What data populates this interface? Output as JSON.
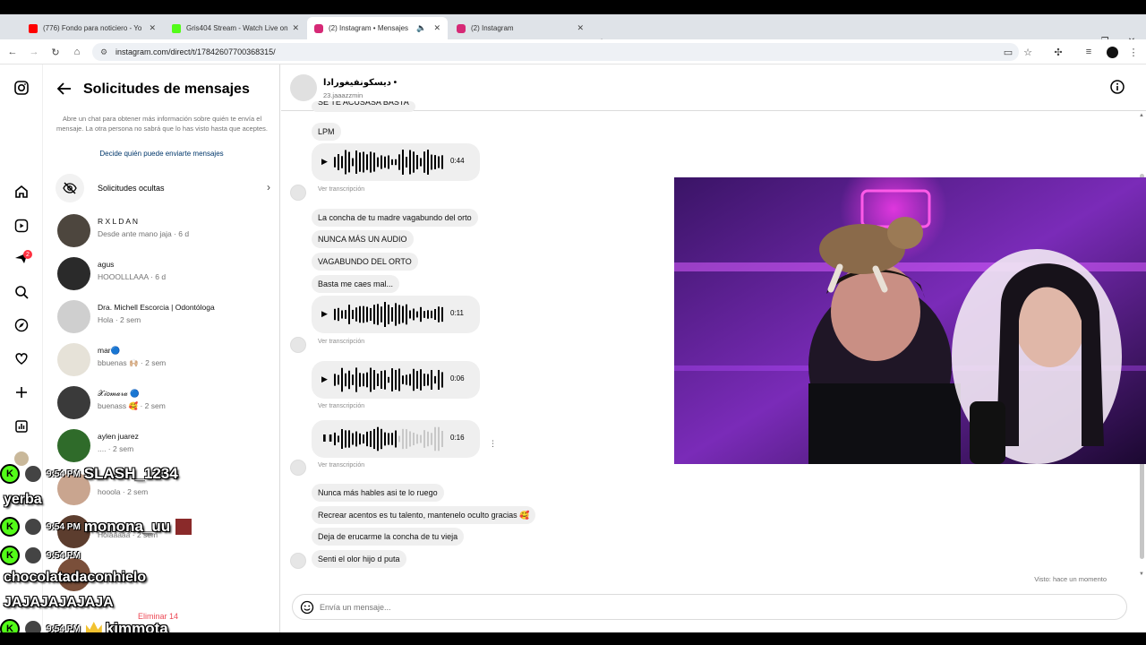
{
  "browser": {
    "tabs": [
      {
        "title": "(776) Fondo para noticiero - Yo",
        "favicon_color": "#ff0000"
      },
      {
        "title": "Gris404 Stream - Watch Live on",
        "favicon_color": "#53fc18"
      },
      {
        "title": "(2) Instagram • Mensajes",
        "favicon_color": "#d62976"
      },
      {
        "title": "(2) Instagram",
        "favicon_color": "#d62976"
      }
    ],
    "new_tab": "+",
    "url": "instagram.com/direct/t/17842607700368315/"
  },
  "rail": {
    "notification_count": "2"
  },
  "requests": {
    "title": "Solicitudes de mensajes",
    "description": "Abre un chat para obtener más información sobre quién te envía el mensaje. La otra persona no sabrá que lo has visto hasta que aceptes.",
    "decide_link": "Decide quién puede enviarte mensajes",
    "hidden_label": "Solicitudes ocultas",
    "items": [
      {
        "name": "R X L D A N",
        "preview": "Desde ante mano jaja · 6 d"
      },
      {
        "name": "agus",
        "preview": "HOOOLLLAAA · 6 d"
      },
      {
        "name": "Dra. Michell Escorcia | Odontóloga",
        "preview": "Hola · 2 sem"
      },
      {
        "name": "mar🔵",
        "preview": "bbuenas 🙌🏼 · 2 sem"
      },
      {
        "name": "𝒳𝒾𝑜𝓂𝒶𝓇𝒶 🔵",
        "preview": "buenass 🥰 · 2 sem"
      },
      {
        "name": "aylen juarez",
        "preview": ".... · 2 sem"
      },
      {
        "name": "",
        "preview": "hooola · 2 sem"
      },
      {
        "name": "",
        "preview": "Holaaaaa · 2 sem"
      },
      {
        "name": "",
        "preview": ""
      }
    ],
    "delete_all": "Eliminar 14"
  },
  "chat": {
    "name": "دیسکونفیغورادا •",
    "username": "23.jaaazzmin",
    "messages": {
      "m0": "SE TE ACUSASA BASTA",
      "m1": "LPM",
      "v1_duration": "0:44",
      "transcript": "Ver transcripción",
      "m2": "La concha de tu madre vagabundo del orto",
      "m3": "NUNCA MÁS UN AUDIO",
      "m4": "VAGABUNDO DEL ORTO",
      "m5": "Basta me caes mal...",
      "v2_duration": "0:11",
      "v3_duration": "0:06",
      "v4_duration": "0:16",
      "m6": "Nunca más hables asi te lo ruego",
      "m7": "Recrear acentos es tu talento, mantenelo oculto gracias 🥰",
      "m8": "Deja de erucarme la concha de tu vieja",
      "m9": "Senti el olor hijo d puta"
    },
    "seen": "Visto: hace un momento",
    "composer_placeholder": "Envía un mensaje..."
  },
  "stream_chat": [
    {
      "time": "9:54 PM",
      "user": "SLASH_1234",
      "message": "yerba"
    },
    {
      "time": "9:54 PM",
      "user": "monona_uu",
      "message": ""
    },
    {
      "time": "9:54 PM",
      "user": "chocolatadaconhielo",
      "message": "JAJAJAJAJAJA"
    },
    {
      "time": "9:54 PM",
      "user": "kimmota",
      "message": ""
    }
  ],
  "colors": {
    "instagram_link": "#00376b",
    "danger": "#ed4956",
    "kick_green": "#53fc18"
  }
}
